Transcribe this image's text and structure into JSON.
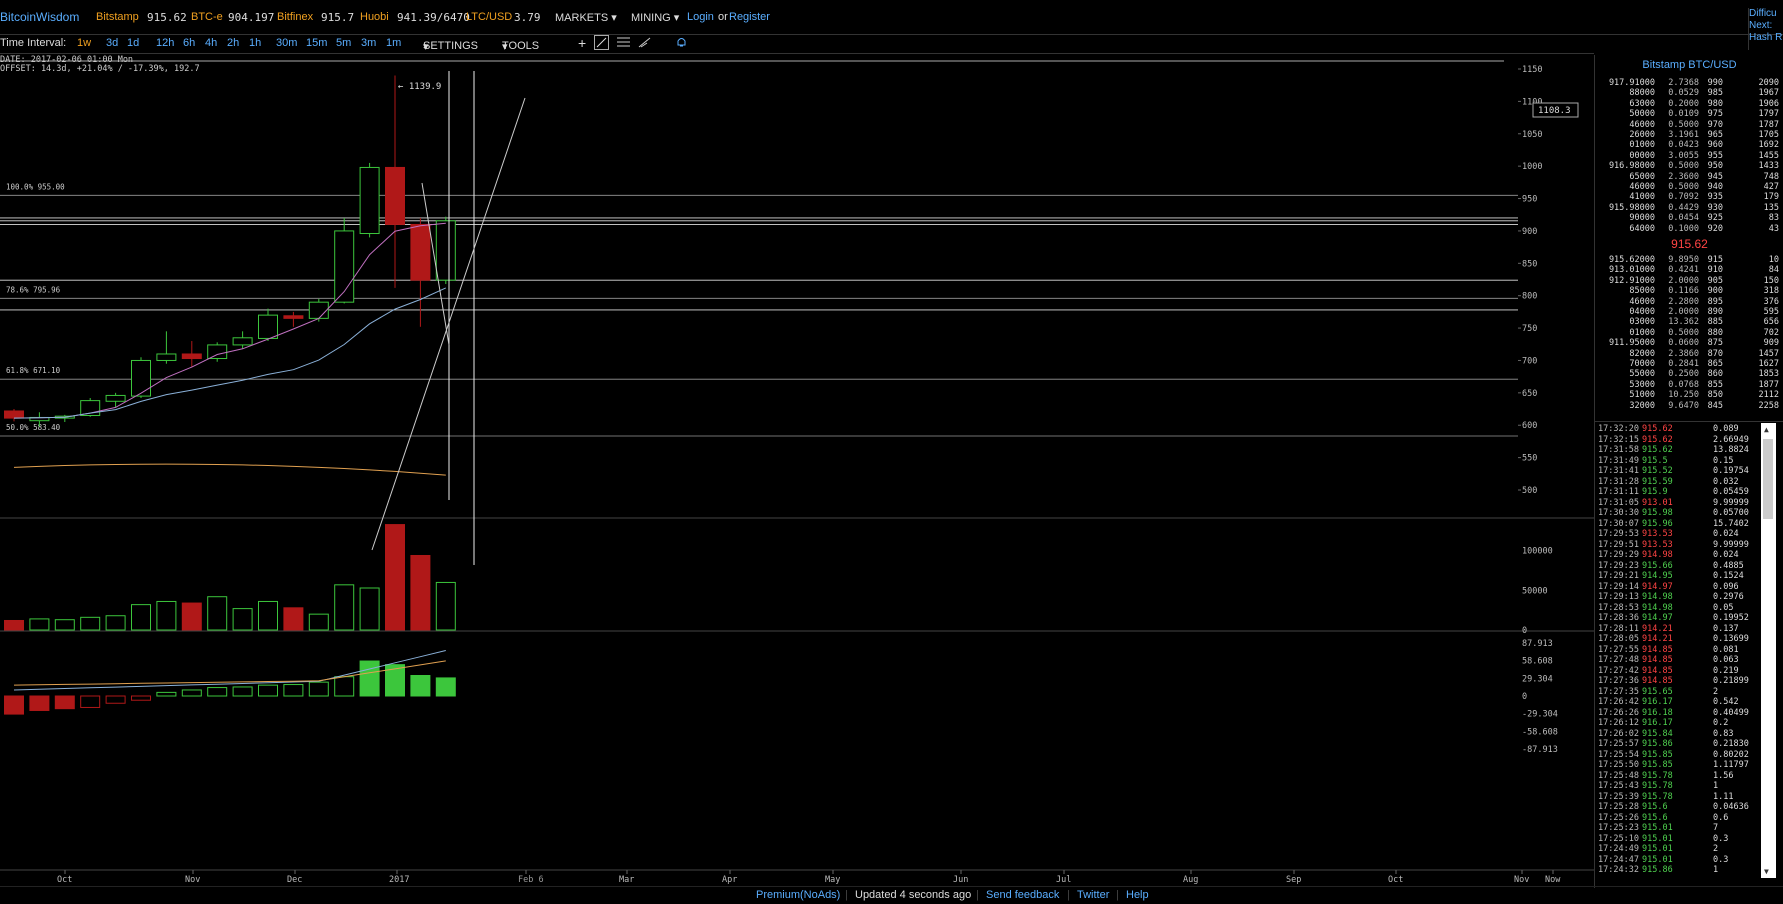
{
  "header": {
    "brand": "BitcoinWisdom",
    "tickers": [
      {
        "name": "Bitstamp",
        "value": "915.62"
      },
      {
        "name": "BTC-e",
        "value": "904.197"
      },
      {
        "name": "Bitfinex",
        "value": "915.7"
      },
      {
        "name": "Huobi",
        "value": "941.39/6470"
      },
      {
        "name": "LTC/USD",
        "value": "3.79"
      }
    ],
    "menus": [
      "MARKETS",
      "MINING"
    ],
    "login": "Login",
    "or": "or",
    "register": "Register",
    "right_labels": [
      "Difficu",
      "Next:",
      "Hash R"
    ]
  },
  "toolbar": {
    "label": "Time Interval:",
    "intervals": [
      "1w",
      "3d",
      "1d",
      "12h",
      "6h",
      "4h",
      "2h",
      "1h",
      "30m",
      "15m",
      "5m",
      "3m",
      "1m"
    ],
    "selected": "1w",
    "settings": "SETTINGS",
    "tools": "TOOLS",
    "tool_icons": [
      "crosshair-icon",
      "line-icon",
      "fib-icon",
      "pencil-icon",
      "bell-icon"
    ]
  },
  "chart": {
    "info_date": "DATE: 2017-02-06 01:00 Mon",
    "info_offset": "OFFSET: 14.3d, +21.04% / -17.39%, 192.7",
    "high_marker": "← 1139.9",
    "cursor_price": "1108.3",
    "fib_labels": [
      "100.0% 955.00",
      "78.6% 795.96",
      "61.8% 671.10",
      "50.0% 583.40"
    ],
    "price_axis": [
      "1150",
      "1100",
      "1050",
      "1000",
      "950",
      "900",
      "850",
      "800",
      "750",
      "700",
      "650",
      "600",
      "550",
      "500"
    ],
    "volume_axis": [
      "100000",
      "50000",
      "0"
    ],
    "macd_axis": [
      "87.913",
      "58.608",
      "29.304",
      "0",
      "-29.304",
      "-58.608",
      "-87.913"
    ],
    "time_axis": [
      "Oct",
      "Nov",
      "Dec",
      "2017",
      "Feb 6",
      "Mar",
      "Apr",
      "May",
      "Jun",
      "Jul",
      "Aug",
      "Sep",
      "Oct",
      "Nov",
      "Now"
    ],
    "colors": {
      "up": "#3cc63c",
      "down": "#b01818",
      "bg": "#000000",
      "grid": "#999999",
      "ma1": "#c070c0",
      "ma2": "#8ab0d8",
      "ma3": "#e0a050"
    }
  },
  "chart_data": {
    "type": "candlestick",
    "interval": "1w",
    "candles": [
      {
        "o": 622,
        "h": 625,
        "l": 606,
        "c": 611
      },
      {
        "o": 607,
        "h": 620,
        "l": 598,
        "c": 612
      },
      {
        "o": 611,
        "h": 616,
        "l": 605,
        "c": 614
      },
      {
        "o": 615,
        "h": 642,
        "l": 613,
        "c": 638
      },
      {
        "o": 637,
        "h": 650,
        "l": 628,
        "c": 646
      },
      {
        "o": 645,
        "h": 705,
        "l": 642,
        "c": 700
      },
      {
        "o": 700,
        "h": 745,
        "l": 695,
        "c": 710
      },
      {
        "o": 710,
        "h": 730,
        "l": 690,
        "c": 703
      },
      {
        "o": 703,
        "h": 728,
        "l": 698,
        "c": 724
      },
      {
        "o": 724,
        "h": 745,
        "l": 718,
        "c": 735
      },
      {
        "o": 734,
        "h": 780,
        "l": 730,
        "c": 770
      },
      {
        "o": 769,
        "h": 775,
        "l": 752,
        "c": 765
      },
      {
        "o": 765,
        "h": 795,
        "l": 760,
        "c": 790
      },
      {
        "o": 790,
        "h": 920,
        "l": 788,
        "c": 900
      },
      {
        "o": 896,
        "h": 1005,
        "l": 890,
        "c": 998
      },
      {
        "o": 998,
        "h": 1139.9,
        "l": 812,
        "c": 910
      },
      {
        "o": 910,
        "h": 920,
        "l": 752,
        "c": 824
      },
      {
        "o": 824,
        "h": 922,
        "l": 818,
        "c": 915.62
      }
    ],
    "volume": [
      12000,
      14000,
      13000,
      16000,
      18000,
      32000,
      36000,
      34000,
      42000,
      27000,
      36000,
      28000,
      20000,
      57000,
      53000,
      133000,
      94000,
      60000
    ],
    "macd_hist": [
      -30,
      -24,
      -21,
      -19,
      -12,
      -7,
      6,
      10,
      14,
      15,
      18,
      19,
      23,
      32,
      58,
      52,
      34,
      30
    ]
  },
  "orderbook": {
    "title": "Bitstamp BTC/USD",
    "last_price": "915.62",
    "asks": [
      [
        "917.91000",
        "2.7368",
        "990",
        "2090"
      ],
      [
        "88000",
        "0.0529",
        "985",
        "1967"
      ],
      [
        "63000",
        "0.2000",
        "980",
        "1906"
      ],
      [
        "50000",
        "0.0109",
        "975",
        "1797"
      ],
      [
        "46000",
        "0.5000",
        "970",
        "1787"
      ],
      [
        "26000",
        "3.1961",
        "965",
        "1705"
      ],
      [
        "01000",
        "0.0423",
        "960",
        "1692"
      ],
      [
        "00000",
        "3.0055",
        "955",
        "1455"
      ],
      [
        "916.98000",
        "0.5000",
        "950",
        "1433"
      ],
      [
        "65000",
        "2.3600",
        "945",
        "748"
      ],
      [
        "46000",
        "0.5000",
        "940",
        "427"
      ],
      [
        "41000",
        "0.7092",
        "935",
        "179"
      ],
      [
        "915.98000",
        "0.4429",
        "930",
        "135"
      ],
      [
        "90000",
        "0.0454",
        "925",
        "83"
      ],
      [
        "64000",
        "0.1000",
        "920",
        "43"
      ]
    ],
    "bids": [
      [
        "915.62000",
        "9.8950",
        "915",
        "10"
      ],
      [
        "913.01000",
        "0.4241",
        "910",
        "84"
      ],
      [
        "912.91000",
        "2.0000",
        "905",
        "150"
      ],
      [
        "85000",
        "0.1166",
        "900",
        "318"
      ],
      [
        "46000",
        "2.2800",
        "895",
        "376"
      ],
      [
        "04000",
        "2.0000",
        "890",
        "595"
      ],
      [
        "03000",
        "13.362",
        "885",
        "656"
      ],
      [
        "01000",
        "0.5000",
        "880",
        "702"
      ],
      [
        "911.95000",
        "0.0600",
        "875",
        "909"
      ],
      [
        "82000",
        "2.3860",
        "870",
        "1457"
      ],
      [
        "70000",
        "0.2841",
        "865",
        "1627"
      ],
      [
        "55000",
        "0.2500",
        "860",
        "1853"
      ],
      [
        "53000",
        "0.0768",
        "855",
        "1877"
      ],
      [
        "51000",
        "10.250",
        "850",
        "2112"
      ],
      [
        "32000",
        "9.6470",
        "845",
        "2258"
      ]
    ]
  },
  "trades": [
    [
      "17:32:20",
      "915.62",
      "0.089",
      "r"
    ],
    [
      "17:32:15",
      "915.62",
      "2.66949",
      "r"
    ],
    [
      "17:31:58",
      "915.62",
      "13.8824",
      "g"
    ],
    [
      "17:31:49",
      "915.5",
      "0.15",
      "g"
    ],
    [
      "17:31:41",
      "915.52",
      "0.19754",
      "g"
    ],
    [
      "17:31:28",
      "915.59",
      "0.032",
      "g"
    ],
    [
      "17:31:11",
      "915.9",
      "0.05459",
      "g"
    ],
    [
      "17:31:05",
      "913.01",
      "9.99999",
      "r"
    ],
    [
      "17:30:30",
      "915.98",
      "0.05700",
      "g"
    ],
    [
      "17:30:07",
      "915.96",
      "15.7402",
      "g"
    ],
    [
      "17:29:53",
      "913.53",
      "0.024",
      "r"
    ],
    [
      "17:29:51",
      "913.53",
      "9.99999",
      "r"
    ],
    [
      "17:29:29",
      "914.98",
      "0.024",
      "r"
    ],
    [
      "17:29:23",
      "915.66",
      "0.4885",
      "g"
    ],
    [
      "17:29:21",
      "914.95",
      "0.1524",
      "g"
    ],
    [
      "17:29:14",
      "914.97",
      "0.096",
      "r"
    ],
    [
      "17:29:13",
      "914.98",
      "0.2976",
      "g"
    ],
    [
      "17:28:53",
      "914.98",
      "0.05",
      "g"
    ],
    [
      "17:28:36",
      "914.97",
      "0.19952",
      "g"
    ],
    [
      "17:28:11",
      "914.21",
      "0.137",
      "r"
    ],
    [
      "17:28:05",
      "914.21",
      "0.13699",
      "r"
    ],
    [
      "17:27:55",
      "914.85",
      "0.081",
      "r"
    ],
    [
      "17:27:48",
      "914.85",
      "0.063",
      "r"
    ],
    [
      "17:27:42",
      "914.85",
      "0.219",
      "r"
    ],
    [
      "17:27:36",
      "914.85",
      "0.21899",
      "r"
    ],
    [
      "17:27:35",
      "915.65",
      "2",
      "g"
    ],
    [
      "17:26:42",
      "916.17",
      "0.542",
      "g"
    ],
    [
      "17:26:26",
      "916.18",
      "0.40499",
      "g"
    ],
    [
      "17:26:12",
      "916.17",
      "0.2",
      "g"
    ],
    [
      "17:26:02",
      "915.84",
      "0.83",
      "g"
    ],
    [
      "17:25:57",
      "915.86",
      "0.21830",
      "g"
    ],
    [
      "17:25:54",
      "915.85",
      "0.80202",
      "g"
    ],
    [
      "17:25:50",
      "915.85",
      "1.11797",
      "g"
    ],
    [
      "17:25:48",
      "915.78",
      "1.56",
      "g"
    ],
    [
      "17:25:43",
      "915.78",
      "1",
      "g"
    ],
    [
      "17:25:39",
      "915.78",
      "1.11",
      "g"
    ],
    [
      "17:25:28",
      "915.6",
      "0.04636",
      "g"
    ],
    [
      "17:25:26",
      "915.6",
      "0.6",
      "g"
    ],
    [
      "17:25:23",
      "915.01",
      "7",
      "g"
    ],
    [
      "17:25:10",
      "915.01",
      "0.3",
      "g"
    ],
    [
      "17:24:49",
      "915.01",
      "2",
      "g"
    ],
    [
      "17:24:47",
      "915.01",
      "0.3",
      "g"
    ],
    [
      "17:24:32",
      "915.86",
      "1",
      "g"
    ]
  ],
  "footer": {
    "premium": "Premium(NoAds)",
    "updated": "Updated 4 seconds ago",
    "feedback": "Send feedback",
    "twitter": "Twitter",
    "help": "Help"
  }
}
